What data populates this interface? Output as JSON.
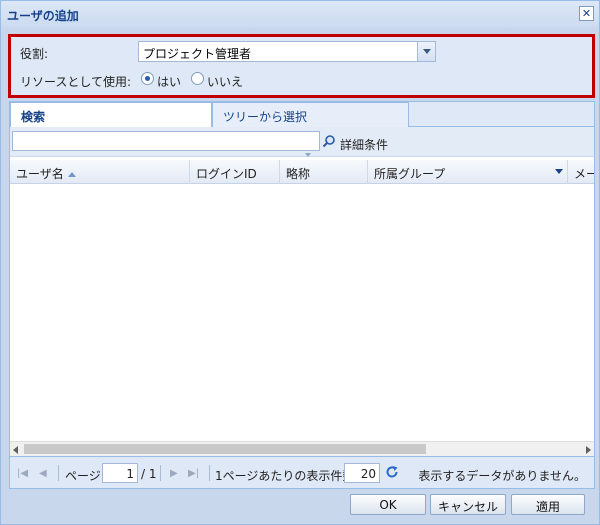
{
  "window": {
    "title": "ユーザの追加",
    "close_label": "✕"
  },
  "form": {
    "role_label": "役割:",
    "role_value": "プロジェクト管理者",
    "use_as_resource_label": "リソースとして使用:",
    "radio_yes": "はい",
    "radio_no": "いいえ",
    "selected": "yes"
  },
  "tabs": {
    "search": "検索",
    "tree": "ツリーから選択",
    "active": "search"
  },
  "search": {
    "input_value": "",
    "advanced_link": "詳細条件"
  },
  "grid": {
    "columns": [
      "ユーザ名",
      "ログインID",
      "略称",
      "所属グループ",
      "メー"
    ],
    "sort_column": "ユーザ名",
    "sort_direction": "asc",
    "rows": []
  },
  "pager": {
    "page_label": "ページ",
    "current_page": "1",
    "total_pages": "/ 1",
    "per_page_label": "1ページあたりの表示件数",
    "per_page_value": "20",
    "status": "表示するデータがありません。"
  },
  "buttons": {
    "ok": "OK",
    "cancel": "キャンセル",
    "apply": "適用"
  }
}
